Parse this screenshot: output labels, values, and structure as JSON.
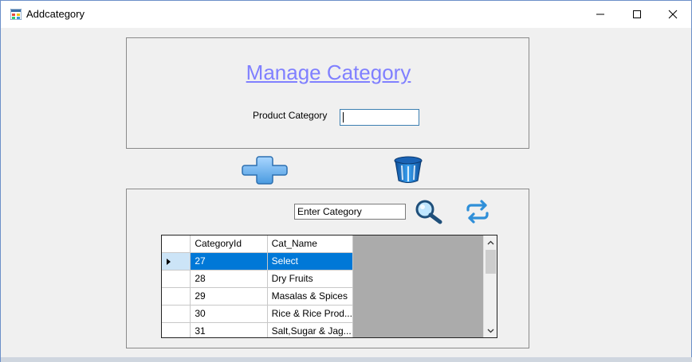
{
  "window": {
    "title": "Addcategory",
    "icon": "app-window-icon",
    "controls": [
      "minimize-icon",
      "maximize-icon",
      "close-icon"
    ]
  },
  "form": {
    "heading": "Manage Category",
    "product_category_label": "Product Category",
    "product_category_value": ""
  },
  "actions": {
    "add_icon": "plus-icon",
    "delete_icon": "trash-icon"
  },
  "search": {
    "value": "Enter Category",
    "search_icon": "magnifier-icon",
    "refresh_icon": "refresh-icon"
  },
  "grid": {
    "columns": [
      "CategoryId",
      "Cat_Name"
    ],
    "rows": [
      {
        "id": "27",
        "name": "Select",
        "selected": true
      },
      {
        "id": "28",
        "name": "Dry Fruits",
        "selected": false
      },
      {
        "id": "29",
        "name": "Masalas & Spices",
        "selected": false
      },
      {
        "id": "30",
        "name": "Rice & Rice Prod...",
        "selected": false
      },
      {
        "id": "31",
        "name": "Salt,Sugar & Jag...",
        "selected": false
      }
    ]
  },
  "colors": {
    "heading": "#8080ff",
    "selection": "#0078d7",
    "icon_blue": "#2f8fd8"
  }
}
